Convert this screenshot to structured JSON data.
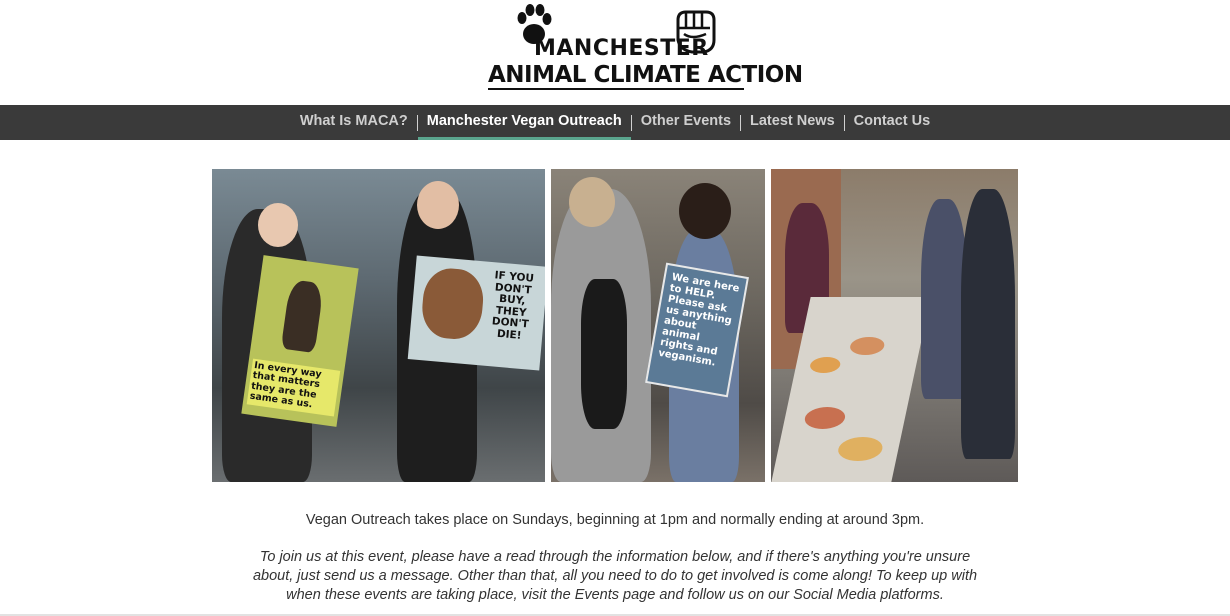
{
  "header": {
    "logo_line1": "MANCHESTER",
    "logo_line2": "ANIMAL CLIMATE ACTION",
    "logo_paw_icon": "paw-print-icon",
    "logo_fist_icon": "raised-fist-icon"
  },
  "nav": {
    "items": [
      {
        "label": "What Is MACA?",
        "active": false
      },
      {
        "label": "Manchester Vegan Outreach",
        "active": true
      },
      {
        "label": "Other Events",
        "active": false
      },
      {
        "label": "Latest News",
        "active": false
      },
      {
        "label": "Contact Us",
        "active": false
      }
    ],
    "accent_color": "#5aa58e",
    "background_color": "#3a3a3a"
  },
  "gallery": {
    "photo1": {
      "sign_a": "In every way that matters they are the same as us.",
      "sign_b": "IF YOU DON'T BUY, THEY DON'T DIE!"
    },
    "photo2": {
      "sign": "We are here to HELP. Please ask us anything about animal rights and veganism."
    }
  },
  "content": {
    "para1": "Vegan Outreach takes place on Sundays, beginning at 1pm and normally ending at around 3pm.",
    "para2": "To join us at this event, please have a read through the information below, and if there's anything you're unsure about, just send us a message. Other than that, all you need to do to get involved is come along! To keep up with when these events are taking place, visit the Events page and follow us on our Social Media platforms."
  }
}
